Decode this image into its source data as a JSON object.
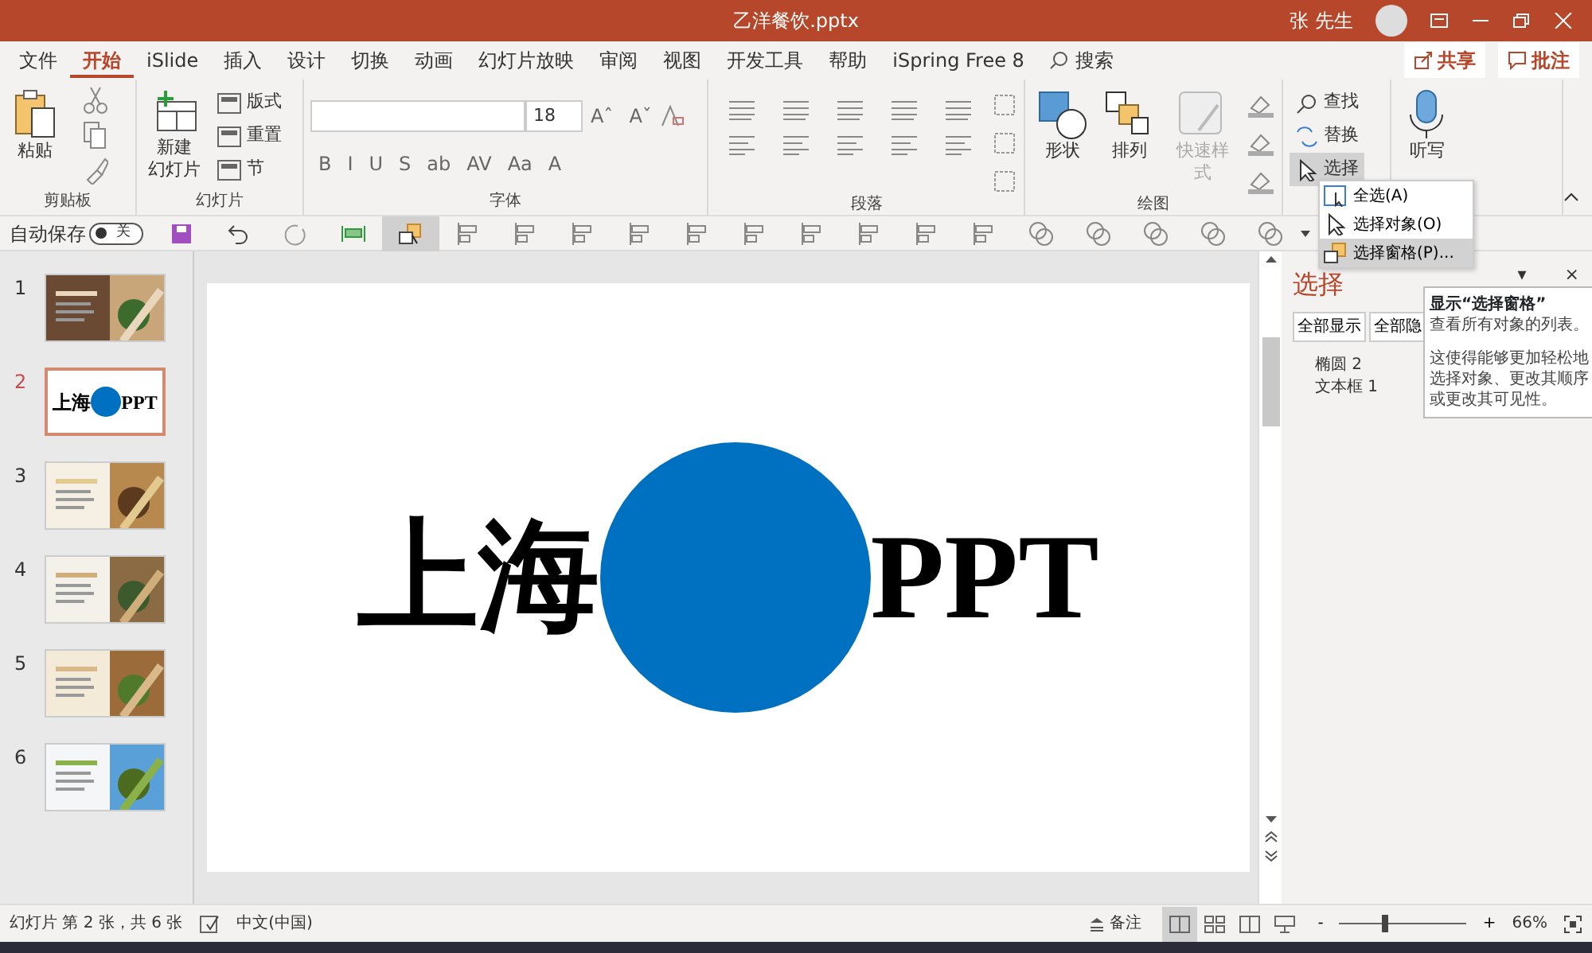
{
  "window": {
    "title": "乙洋餐饮.pptx",
    "user": "张 先生"
  },
  "menu_tabs": [
    {
      "label": "文件",
      "selected": false
    },
    {
      "label": "开始",
      "selected": true
    },
    {
      "label": "iSlide",
      "selected": false
    },
    {
      "label": "插入",
      "selected": false
    },
    {
      "label": "设计",
      "selected": false
    },
    {
      "label": "切换",
      "selected": false
    },
    {
      "label": "动画",
      "selected": false
    },
    {
      "label": "幻灯片放映",
      "selected": false
    },
    {
      "label": "审阅",
      "selected": false
    },
    {
      "label": "视图",
      "selected": false
    },
    {
      "label": "开发工具",
      "selected": false
    },
    {
      "label": "帮助",
      "selected": false
    },
    {
      "label": "iSpring Free 8",
      "selected": false
    }
  ],
  "search": {
    "label": "搜索"
  },
  "header_buttons": [
    {
      "label": "共享",
      "kind": "share"
    },
    {
      "label": "批注",
      "kind": "comment"
    }
  ],
  "ribbon": {
    "groups": [
      {
        "kind": "clipboard",
        "label": "剪贴板",
        "paste": "粘贴"
      },
      {
        "kind": "slides",
        "label": "幻灯片",
        "new_slide": "新建幻灯片",
        "small": [
          "版式",
          "重置",
          "节"
        ]
      },
      {
        "kind": "font",
        "label": "字体",
        "font_size": "18",
        "size_buttons": [
          "Aˆ",
          "Aˇ"
        ],
        "format_buttons": [
          "B",
          "I",
          "U",
          "S",
          "ab",
          "AV",
          "Aa",
          "A"
        ]
      },
      {
        "kind": "paragraph",
        "label": "段落"
      },
      {
        "kind": "drawing",
        "label": "绘图",
        "large": [
          {
            "label": "形状",
            "disabled": false
          },
          {
            "label": "排列",
            "disabled": false
          },
          {
            "label": "快速样式",
            "disabled": true
          }
        ]
      },
      {
        "kind": "editing",
        "items": [
          {
            "label": "查找",
            "pressed": false
          },
          {
            "label": "替换",
            "pressed": false
          },
          {
            "label": "选择",
            "pressed": true
          }
        ]
      },
      {
        "kind": "voice",
        "dictate": "听写"
      }
    ]
  },
  "quick_access": {
    "autosave_label": "自动保存",
    "autosave_on": false,
    "autosave_state": "关",
    "selection_pane_on": true
  },
  "select_menu": {
    "items": [
      {
        "label": "全选(A)",
        "selected": false
      },
      {
        "label": "选择对象(O)",
        "selected": false
      },
      {
        "label": "选择窗格(P)...",
        "selected": true
      }
    ]
  },
  "slides": [
    {
      "number": "1",
      "selected": false,
      "kind": "picture"
    },
    {
      "number": "2",
      "selected": true,
      "kind": "title",
      "texts": [
        "上海",
        "PPT"
      ]
    },
    {
      "number": "3",
      "selected": false,
      "kind": "picture"
    },
    {
      "number": "4",
      "selected": false,
      "kind": "picture"
    },
    {
      "number": "5",
      "selected": false,
      "kind": "picture"
    },
    {
      "number": "6",
      "selected": false,
      "kind": "picture"
    }
  ],
  "slide": {
    "texts": [
      "上海",
      "PPT"
    ]
  },
  "selection_pane": {
    "title": "选择",
    "menu_caret": "▾",
    "close": "×",
    "buttons": [
      "全部显示",
      "全部隐"
    ],
    "items": [
      "椭圆 2",
      "文本框 1"
    ]
  },
  "tooltip": {
    "title": "显示“选择窗格”",
    "lines": [
      "查看所有对象的列表。",
      "这使得能够更加轻松地选择对象、更改其顺序或更改其可见性。"
    ]
  },
  "status_bar": {
    "slide_info": "幻灯片 第 2 张，共 6 张",
    "language": "中文(中国)",
    "notes": "备注",
    "zoom_out": "-",
    "zoom_in": "+",
    "zoom": {
      "level": 0.35
    },
    "zoom_text": "66%"
  }
}
